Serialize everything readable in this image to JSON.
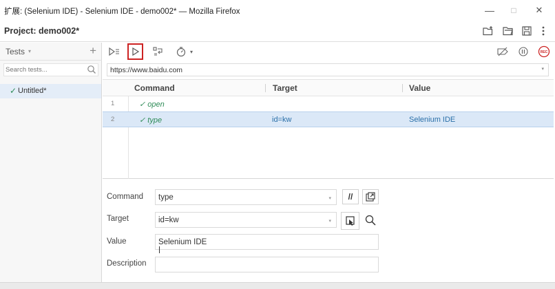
{
  "window": {
    "title": "扩展: (Selenium IDE) - Selenium IDE - demo002* — Mozilla Firefox",
    "minimize_glyph": "—",
    "maximize_glyph": "□",
    "close_glyph": "✕"
  },
  "project": {
    "title": "Project:  demo002*",
    "icons": [
      "new-folder-icon",
      "open-folder-icon",
      "save-icon",
      "more-vertical-icon"
    ]
  },
  "tests_panel": {
    "label": "Tests",
    "caret": "▾",
    "add_glyph": "+",
    "search_placeholder": "Search tests...",
    "items": [
      {
        "check": "✓",
        "name": "Untitled*"
      }
    ]
  },
  "toolbar": {
    "run_all_icon": "run-all-tests-icon",
    "run_icon": "run-current-test-icon",
    "step_icon": "step-over-icon",
    "speed_icon": "speed-timer-icon",
    "speed_caret": "▾",
    "breakpoints_icon": "disable-breakpoints-icon",
    "pause_icon": "pause-icon",
    "record_icon": "record-icon",
    "record_label": "REC"
  },
  "url": {
    "value": "https://www.baidu.com",
    "caret": "▾"
  },
  "table": {
    "headers": {
      "command": "Command",
      "target": "Target",
      "value": "Value"
    },
    "rows": [
      {
        "num": "1",
        "command": "✓ open",
        "target": "",
        "value": ""
      },
      {
        "num": "2",
        "command": "✓ type",
        "target": "id=kw",
        "value": "Selenium IDE"
      }
    ]
  },
  "editor": {
    "command_label": "Command",
    "command_value": "type",
    "comment_glyph": "//",
    "target_label": "Target",
    "target_value": "id=kw",
    "value_label": "Value",
    "value_value": "Selenium IDE",
    "description_label": "Description",
    "description_value": "",
    "caret": "▾"
  },
  "colors": {
    "highlight_red": "#cc2222",
    "selected_row": "#dbe8f7",
    "pass_green": "#2e8b57",
    "link_blue": "#2a6fa8"
  }
}
